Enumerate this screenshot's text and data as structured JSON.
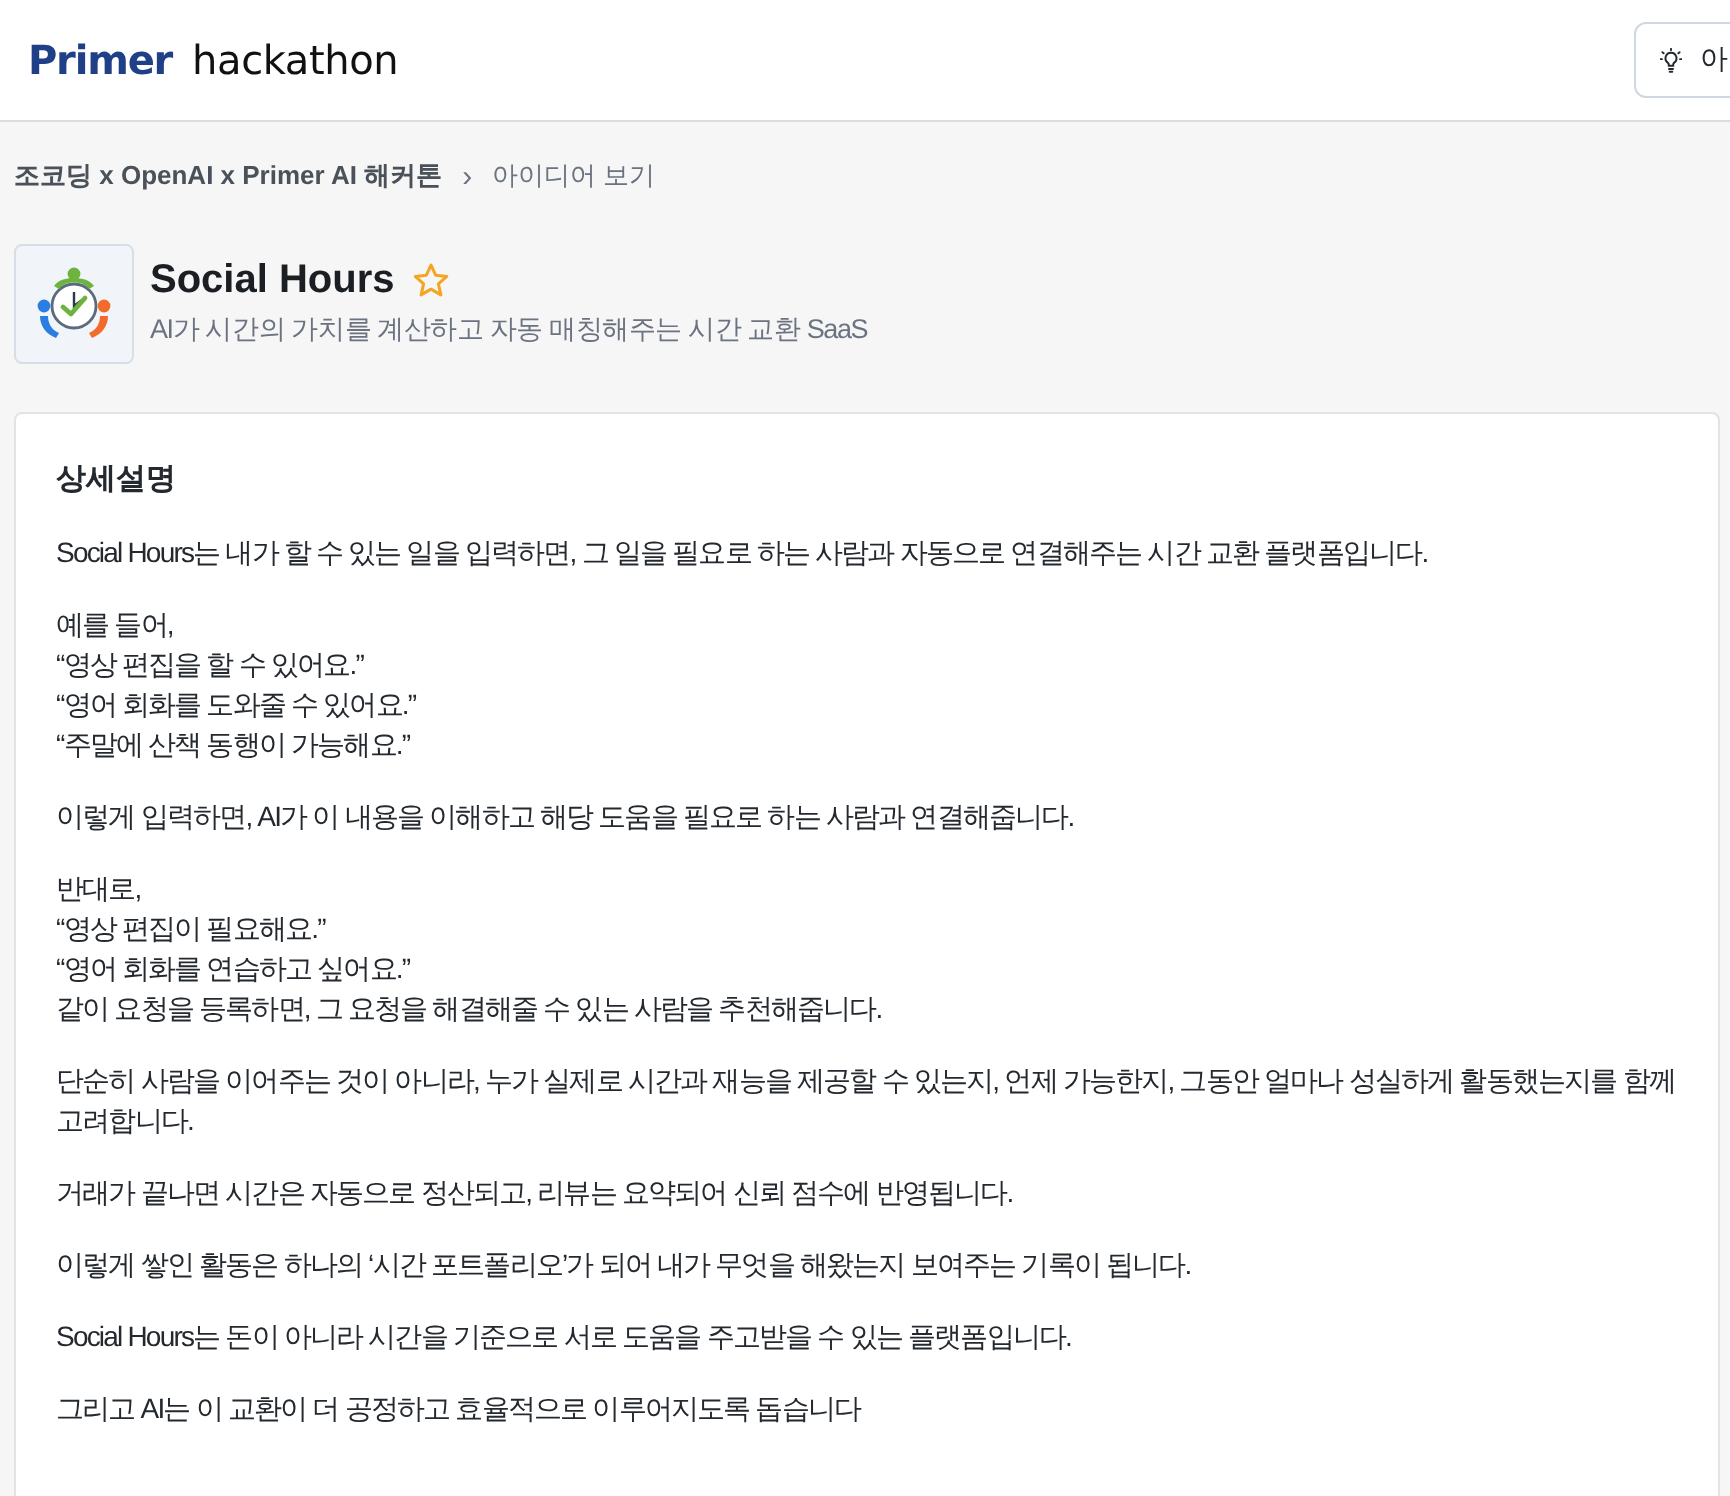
{
  "header": {
    "logo": {
      "brand": "Primer",
      "product": "hackathon"
    },
    "action_button": {
      "label": "아"
    }
  },
  "breadcrumb": {
    "separator": "›",
    "items": [
      {
        "label": "조코딩 x OpenAI x Primer AI 해커톤",
        "current": false
      },
      {
        "label": "아이디어 보기",
        "current": true
      }
    ]
  },
  "project": {
    "title": "Social Hours",
    "starred": false,
    "tagline": "AI가 시간의 가치를 계산하고 자동 매칭해주는 시간 교환 SaaS"
  },
  "description": {
    "heading": "상세설명",
    "paragraphs": [
      {
        "lines": [
          "Social Hours는 내가 할 수 있는 일을 입력하면, 그 일을 필요로 하는 사람과 자동으로 연결해주는 시간 교환 플랫폼입니다."
        ]
      },
      {
        "lines": [
          "예를 들어,",
          "“영상 편집을 할 수 있어요.”",
          "“영어 회화를 도와줄 수 있어요.”",
          "“주말에 산책 동행이 가능해요.”"
        ]
      },
      {
        "lines": [
          "이렇게 입력하면, AI가 이 내용을 이해하고 해당 도움을 필요로 하는 사람과 연결해줍니다."
        ]
      },
      {
        "lines": [
          "반대로,",
          "“영상 편집이 필요해요.”",
          "“영어 회화를 연습하고 싶어요.”",
          "같이 요청을 등록하면, 그 요청을 해결해줄 수 있는 사람을 추천해줍니다."
        ]
      },
      {
        "lines": [
          "단순히 사람을 이어주는 것이 아니라, 누가 실제로 시간과 재능을 제공할 수 있는지, 언제 가능한지, 그동안 얼마나 성실하게 활동했는지를 함께 고려합니다."
        ]
      },
      {
        "lines": [
          "거래가 끝나면 시간은 자동으로 정산되고, 리뷰는 요약되어 신뢰 점수에 반영됩니다."
        ]
      },
      {
        "lines": [
          "이렇게 쌓인 활동은 하나의 ‘시간 포트폴리오’가 되어 내가 무엇을 해왔는지 보여주는 기록이 됩니다."
        ]
      },
      {
        "lines": [
          "Social Hours는 돈이 아니라 시간을 기준으로 서로 도움을 주고받을 수 있는 플랫폼입니다."
        ]
      },
      {
        "lines": [
          "그리고 AI는 이 교환이 더 공정하고 효율적으로 이루어지도록 돕습니다"
        ]
      }
    ]
  }
}
